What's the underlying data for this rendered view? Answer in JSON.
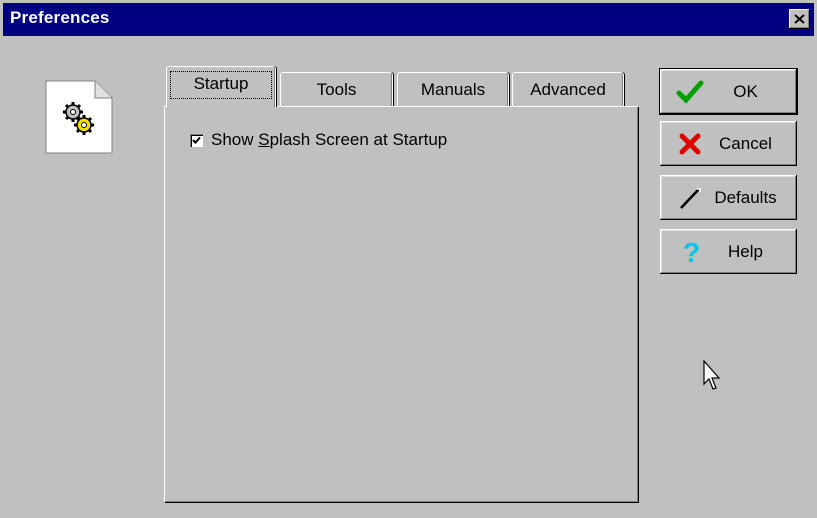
{
  "window": {
    "title": "Preferences"
  },
  "tabs": [
    {
      "label": "Startup",
      "active": true
    },
    {
      "label": "Tools",
      "active": false
    },
    {
      "label": "Manuals",
      "active": false
    },
    {
      "label": "Advanced",
      "active": false
    }
  ],
  "startup": {
    "splash_checkbox": {
      "label_before": "Show ",
      "label_mnemonic": "S",
      "label_after": "plash Screen at Startup",
      "checked": true
    }
  },
  "buttons": {
    "ok": "OK",
    "cancel": "Cancel",
    "defaults": "Defaults",
    "help": "Help"
  },
  "icons": {
    "app": "gears-document-icon",
    "close": "close-icon",
    "ok": "green-checkmark-icon",
    "cancel": "red-x-icon",
    "defaults": "wand-icon",
    "help": "question-mark-icon"
  },
  "colors": {
    "titlebar": "#000080",
    "face": "#c0c0c0",
    "ok_check": "#00a000",
    "cancel_x": "#e00000",
    "help_q": "#00c8e8"
  }
}
